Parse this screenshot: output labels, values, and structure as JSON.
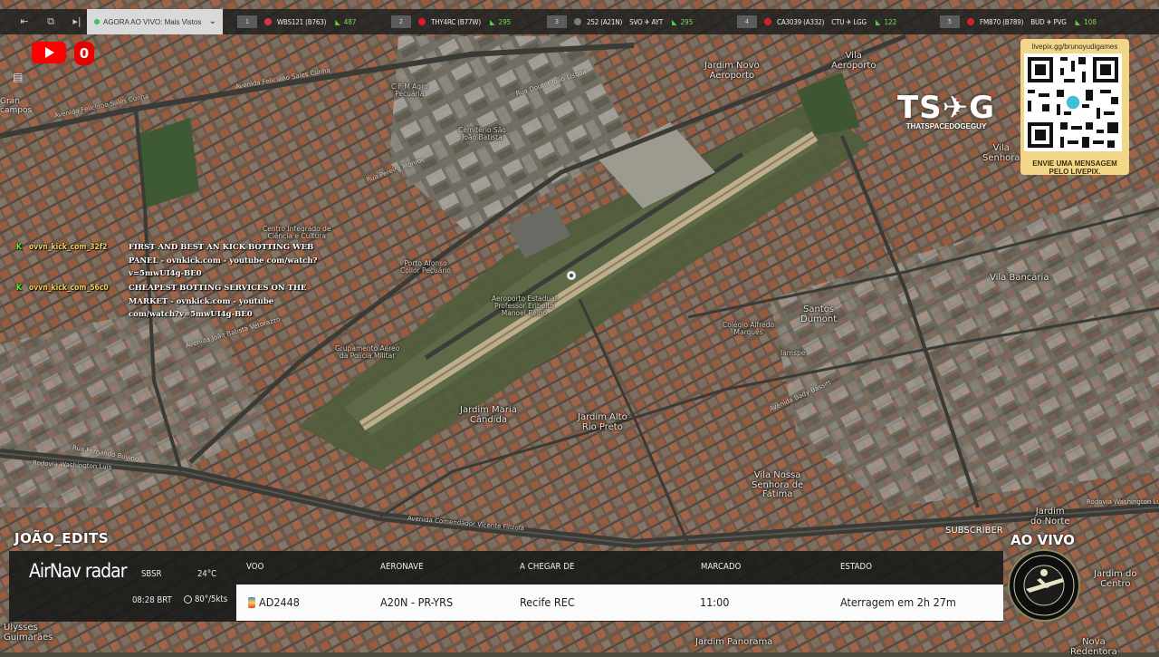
{
  "topbar": {
    "live_label": "AGORA AO VIVO: Mais Vistos",
    "flights": [
      {
        "num": "1",
        "code": "WBS121 (B763)",
        "route": "",
        "score": "487",
        "logo": "#d6344a"
      },
      {
        "num": "2",
        "code": "THY4RC (B77W)",
        "route": "",
        "score": "295",
        "logo": "#e0192d"
      },
      {
        "num": "3",
        "code": "252 (A21N)",
        "route": "SVO ✈ AYT",
        "score": "295",
        "logo": "#7c7c7c"
      },
      {
        "num": "4",
        "code": "CA3039 (A332)",
        "route": "CTU ✈ LGG",
        "score": "122",
        "logo": "#d2202e"
      },
      {
        "num": "5",
        "code": "FM870 (B789)",
        "route": "BUD ✈ PVG",
        "score": "108",
        "logo": "#d2202e"
      }
    ]
  },
  "youtube": {
    "count": "0"
  },
  "side_label": "Gran\ncampos",
  "chat": [
    {
      "user": "ovvn_kick_com_32f2",
      "text": "FIRST AND BEST AN KICK BOTTING WEB PANEL - ovnkick.com - youtube com/watch?v=5mwUI4g-BE0"
    },
    {
      "user": "ovvn_kick_com_56c0",
      "text": "CHEAPEST BOTTING SERVICES ON THE MARKET - ovnkick.com - youtube com/watch?v=5mwUI4g-BE0"
    }
  ],
  "branding": {
    "ts_logo": "TS✈G",
    "ts_sub": "THATSPACEDOGEGUY",
    "livepix_url": "livepix.gg/brunoyudigames",
    "livepix_msg": "ENVIE UMA MENSAGEM PELO LIVEPIX."
  },
  "map_labels": {
    "jardim_novo": "Jardim Novo\nAeroporto",
    "vila_aeroporto": "Vila\nAeroporto",
    "cemiterio": "Cemitério São\nJoão Batista",
    "cfm": "C F M Agro\nPecuária",
    "centro_integrado": "Centro Integrado de\nCiência e Cultura",
    "porto_alegre": "Porto Afonso\nCollor Pecuário",
    "aeroporto": "Aeroporto Estadual\nProfessor Eribelto\nManoel Reino",
    "grupamento": "Grupamento Aéreo\nda Polícia Militar",
    "jardim_maria": "Jardim Maria\nCândida",
    "jardim_alto": "Jardim Alto\nRio Preto",
    "santos_dumont": "Santos\nDumont",
    "colegio": "Colégio Alfredo\nMarquês",
    "vila_bancaria": "Vila Bancária",
    "vila_nossa": "Vila Nossa\nSenhora de\nFátima",
    "jardim_norte": "Jardim\ndo Norte",
    "jardim_centro": "Jardim do\nCentro",
    "nova_redentora": "Nova\nRedentora",
    "jardim_panorama": "Jardim Panorama",
    "ulysses": "Ulysses\nGuimarães",
    "vila_senhora": "Vila\nSenhora",
    "iamspe": "Iamspe",
    "roads": {
      "feliciano": "Avenida Feliciano Sales Cunha",
      "feliciano2": "Avenida Feliciano Sales Cunha",
      "joao_lisboa": "Rua Doutor João Lisboa",
      "washington": "Rodovia Washington Luís",
      "comendador": "Avenida Comendador Vicente Filizola",
      "washington2": "Rodovia Washington Luís",
      "batista": "Avenida João Batista Vetorazzo",
      "bady": "Avenida Bady Bassitt",
      "fernando": "Rua Fernando Buvino",
      "pereira": "Rua Pereira Monroe"
    }
  },
  "bottom": {
    "channel": "JOÃO_EDITS",
    "subscriber": "SUBSCRIBER",
    "ao_vivo": "AO VIVO",
    "brand_main": "AirNav",
    "brand_sub": "radar",
    "airport_code": "SBSR",
    "temp": "24°C",
    "time": "08:28 BRT",
    "wind": "80°/5kts",
    "headers": {
      "voo": "VOO",
      "aeronave": "AERONAVE",
      "origem": "A CHEGAR DE",
      "marcado": "MARCADO",
      "estado": "ESTADO"
    },
    "row": {
      "voo": "AD2448",
      "aeronave": "A20N - PR-YRS",
      "origem": "Recife REC",
      "marcado": "11:00",
      "estado": "Aterragem em 2h 27m"
    }
  }
}
